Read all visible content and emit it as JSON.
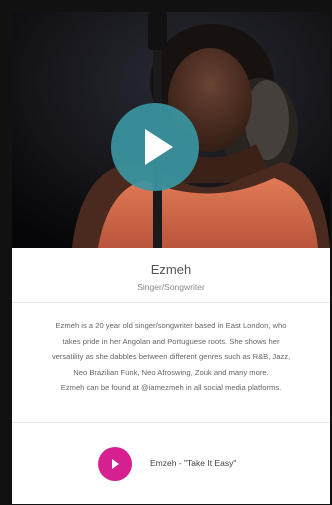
{
  "artist": {
    "name": "Ezmeh",
    "role": "Singer/Songwriter",
    "bio": [
      "Ezmeh is a 20 year old singer/songwriter based in East London, who",
      "takes pride in her Angolan and Portuguese roots. She shows her",
      "versatility as she dabbles between different genres such as R&B, Jazz,",
      "Neo Brazilian Funk, Neo Afroswing, Zouk and many more.",
      "Ezmeh can be found at @iamezmeh in all social media platforms."
    ]
  },
  "video": {
    "play_icon": "play-icon",
    "accent": "#3a96a2"
  },
  "track": {
    "title": "Emzeh - \"Take It Easy\"",
    "play_icon": "play-icon",
    "accent": "#d6208f"
  }
}
